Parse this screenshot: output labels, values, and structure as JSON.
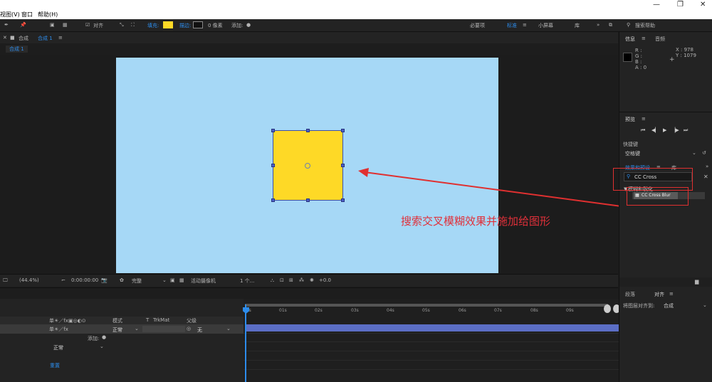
{
  "menu": {
    "items": [
      "视图(V)",
      "窗口",
      "帮助(H)"
    ]
  },
  "window_controls": {
    "minimize": "—",
    "maximize": "❐",
    "close": "✕"
  },
  "toolbar": {
    "align_label": "对齐",
    "fill_label": "填充:",
    "stroke_label": "描边:",
    "stroke_width": "0 像素",
    "add_label": "添加:",
    "workspaces": [
      "必要项",
      "标准",
      "小屏幕",
      "库"
    ],
    "search_help": "搜索帮助",
    "fill_color": "#fed926",
    "stroke_color": "#111111",
    "accent_color": "#2d8ceb"
  },
  "composition": {
    "panel_label": "合成",
    "tab_name": "合成 1",
    "sub_tab": "合成 1"
  },
  "viewer_bar": {
    "zoom": "(44.4%)",
    "timecode": "0:00:00:00",
    "resolution": "完整",
    "camera": "活动摄像机",
    "views": "1 个...",
    "exposure": "+0.0"
  },
  "info_panel": {
    "tab_info": "信息",
    "tab_audio": "音频",
    "r": "R :",
    "g": "G :",
    "b": "B :",
    "a": "A : 0",
    "x": "X : 978",
    "y": "Y : 1079"
  },
  "preview_panel": {
    "title": "预览",
    "shortcut_label": "快捷键",
    "shortcut_value": "空格键"
  },
  "effects_panel": {
    "title": "效果和预设",
    "tab_lib": "库",
    "search_value": "CC Cross",
    "category": "模糊和锐化",
    "result": "CC Cross Blur"
  },
  "annotation": {
    "text": "搜索交叉模糊效果并施加给图形",
    "color": "#e0303a"
  },
  "timeline": {
    "ruler": [
      "00s",
      "01s",
      "02s",
      "03s",
      "04s",
      "05s",
      "06s",
      "07s",
      "08s",
      "09s"
    ],
    "columns": [
      "模式",
      "T",
      "TrkMat",
      "父级"
    ],
    "mode_value": "正常",
    "parent_value": "无",
    "add_label": "添加:",
    "mode2_value": "正常",
    "reset_label": "重置"
  },
  "align_panel": {
    "tab_paragraph": "段落",
    "tab_align": "对齐",
    "align_to_label": "将图层对齐到:",
    "align_to_value": "合成"
  }
}
